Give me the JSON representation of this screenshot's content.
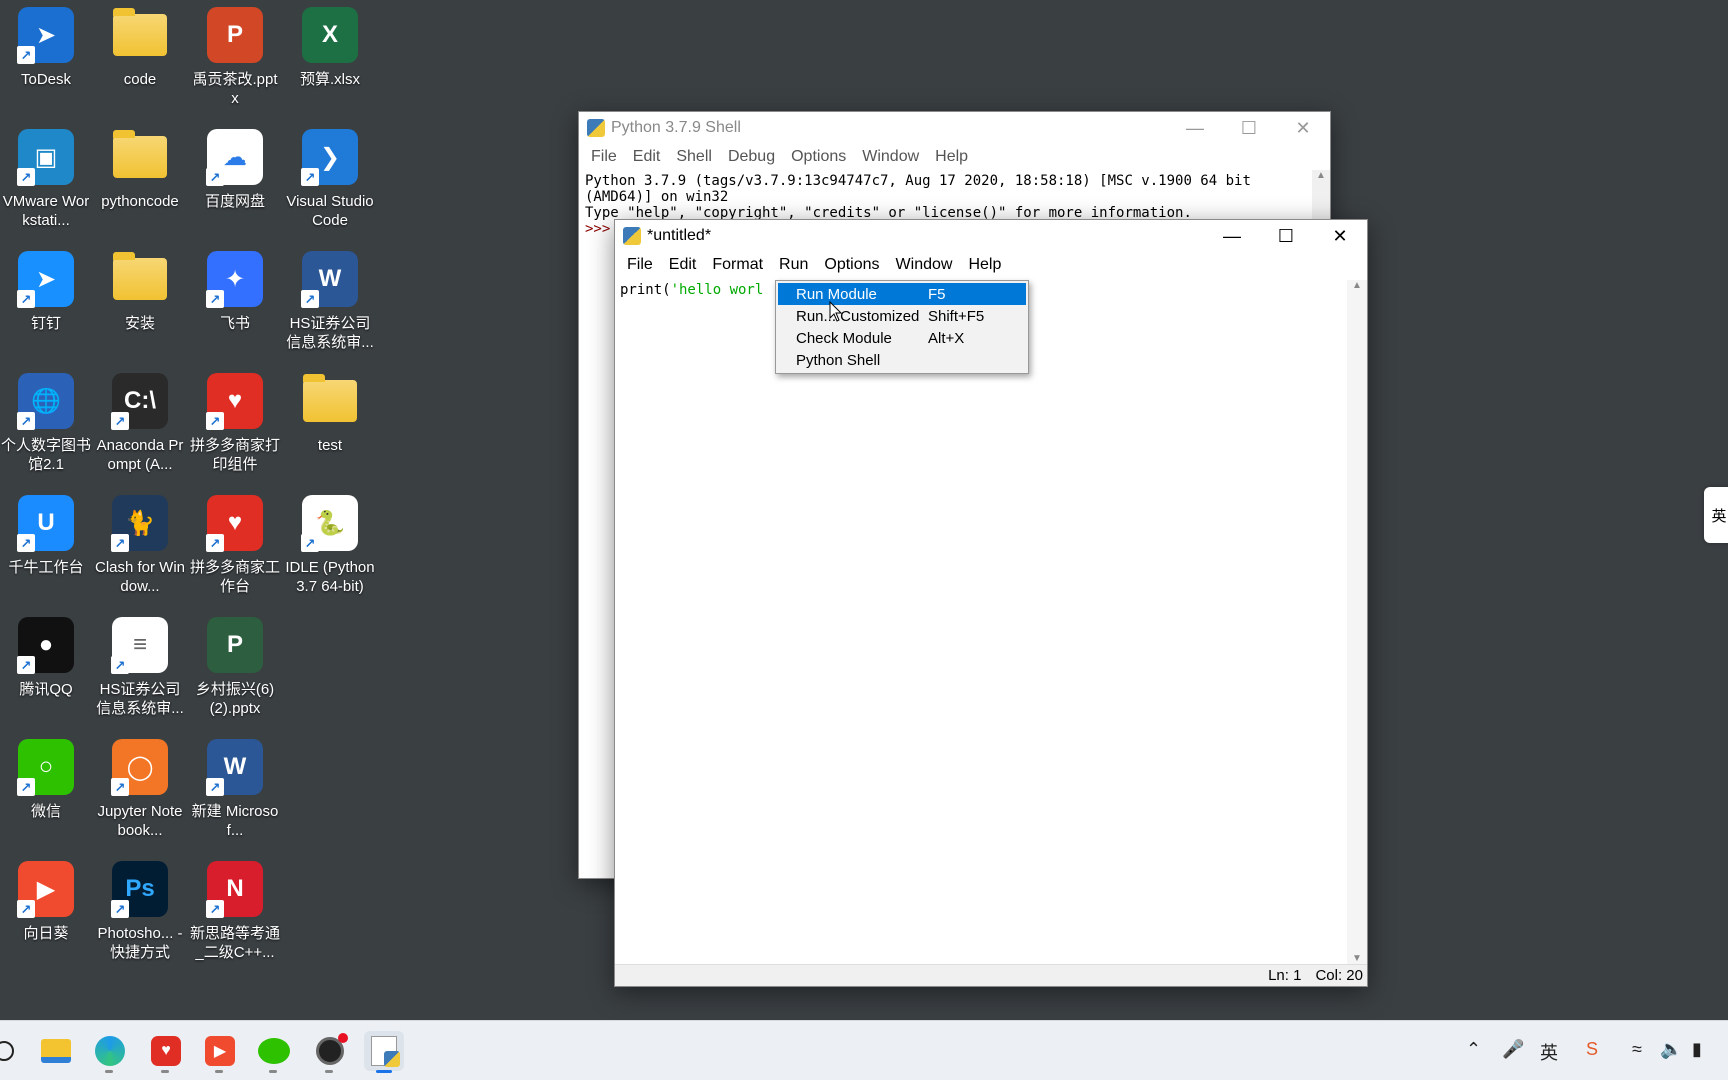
{
  "desktop": {
    "icons": [
      {
        "label": "ToDesk",
        "icon": "todesk-icon"
      },
      {
        "label": "code",
        "icon": "folder-icon"
      },
      {
        "label": "禹贡茶改.pptx",
        "icon": "powerpoint-icon"
      },
      {
        "label": "预算.xlsx",
        "icon": "excel-icon"
      },
      {
        "label": "VMware Workstati...",
        "icon": "vmware-icon"
      },
      {
        "label": "pythoncode",
        "icon": "folder-icon"
      },
      {
        "label": "百度网盘",
        "icon": "baidu-netdisk-icon"
      },
      {
        "label": "Visual Studio Code",
        "icon": "vscode-icon"
      },
      {
        "label": "钉钉",
        "icon": "dingtalk-icon"
      },
      {
        "label": "安装",
        "icon": "folder-icon"
      },
      {
        "label": "飞书",
        "icon": "feishu-icon"
      },
      {
        "label": "HS证券公司信息系统审...",
        "icon": "word-icon"
      },
      {
        "label": "个人数字图书馆2.1",
        "icon": "globe-icon"
      },
      {
        "label": "Anaconda Prompt (A...",
        "icon": "terminal-icon"
      },
      {
        "label": "拼多多商家打印组件",
        "icon": "pinduoduo-icon"
      },
      {
        "label": "test",
        "icon": "folder-icon"
      },
      {
        "label": "千牛工作台",
        "icon": "qianniu-icon"
      },
      {
        "label": "Clash for Window...",
        "icon": "clash-icon"
      },
      {
        "label": "拼多多商家工作台",
        "icon": "pinduoduo-icon"
      },
      {
        "label": "IDLE (Python 3.7 64-bit)",
        "icon": "python-idle-icon"
      },
      {
        "label": "腾讯QQ",
        "icon": "qq-icon"
      },
      {
        "label": "HS证券公司信息系统审...",
        "icon": "text-document-icon"
      },
      {
        "label": "乡村振兴(6)(2).pptx",
        "icon": "pptx-thumbnail-icon"
      },
      {
        "label": "微信",
        "icon": "wechat-icon"
      },
      {
        "label": "Jupyter Notebook...",
        "icon": "jupyter-icon"
      },
      {
        "label": "新建 Microsof...",
        "icon": "word-icon"
      },
      {
        "label": "向日葵",
        "icon": "sunflower-icon"
      },
      {
        "label": "Photosho... - 快捷方式",
        "icon": "photoshop-icon"
      },
      {
        "label": "新思路等考通_二级C++...",
        "icon": "xinsilu-icon"
      }
    ]
  },
  "shell_window": {
    "title": "Python 3.7.9 Shell",
    "menu": [
      "File",
      "Edit",
      "Shell",
      "Debug",
      "Options",
      "Window",
      "Help"
    ],
    "line1": "Python 3.7.9 (tags/v3.7.9:13c94747c7, Aug 17 2020, 18:58:18) [MSC v.1900 64 bit",
    "line2": "(AMD64)] on win32",
    "line3": "Type \"help\", \"copyright\", \"credits\" or \"license()\" for more information.",
    "prompt": ">>>"
  },
  "editor_window": {
    "title": "*untitled*",
    "menu": [
      "File",
      "Edit",
      "Format",
      "Run",
      "Options",
      "Window",
      "Help"
    ],
    "code_func": "print(",
    "code_str": "'hello worl",
    "status_ln": "Ln: 1",
    "status_col": "Col: 20"
  },
  "run_menu": {
    "items": [
      {
        "label": "Run Module",
        "shortcut": "F5"
      },
      {
        "label": "Run... Customized",
        "shortcut": "Shift+F5"
      },
      {
        "label": "Check Module",
        "shortcut": "Alt+X"
      },
      {
        "label": "Python Shell",
        "shortcut": ""
      }
    ]
  },
  "ime_indicator": "英",
  "tray": {
    "ime": "英"
  }
}
